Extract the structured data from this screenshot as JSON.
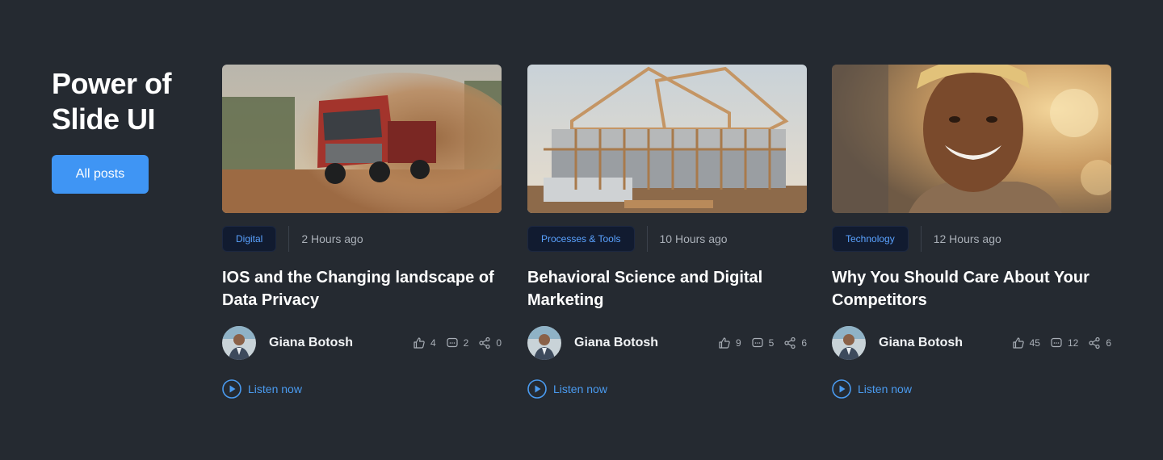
{
  "intro": {
    "title_line1": "Power of",
    "title_line2": "Slide UI",
    "all_posts_label": "All posts"
  },
  "colors": {
    "background": "#252a31",
    "accent": "#3f95f4",
    "tag_background": "#111b30",
    "tag_text": "#5aa2ff",
    "link": "#4a9bf0"
  },
  "icons": {
    "like": "thumbs-up-icon",
    "comment": "comment-icon",
    "share": "share-icon",
    "play": "play-circle-icon"
  },
  "posts": [
    {
      "image": "truck-in-dust-photo",
      "tag": "Digital",
      "time": "2 Hours ago",
      "title": "IOS and the Changing landscape of Data Privacy",
      "author": "Giana Botosh",
      "likes": "4",
      "comments": "2",
      "shares": "0",
      "listen_label": "Listen now"
    },
    {
      "image": "house-construction-frame-photo",
      "tag": "Processes & Tools",
      "time": "10 Hours ago",
      "title": "Behavioral Science and Digital Marketing",
      "author": "Giana Botosh",
      "likes": "9",
      "comments": "5",
      "shares": "6",
      "listen_label": "Listen now"
    },
    {
      "image": "smiling-worker-portrait-photo",
      "tag": "Technology",
      "time": "12 Hours ago",
      "title": "Why You Should Care About Your Competitors",
      "author": "Giana Botosh",
      "likes": "45",
      "comments": "12",
      "shares": "6",
      "listen_label": "Listen now"
    }
  ]
}
